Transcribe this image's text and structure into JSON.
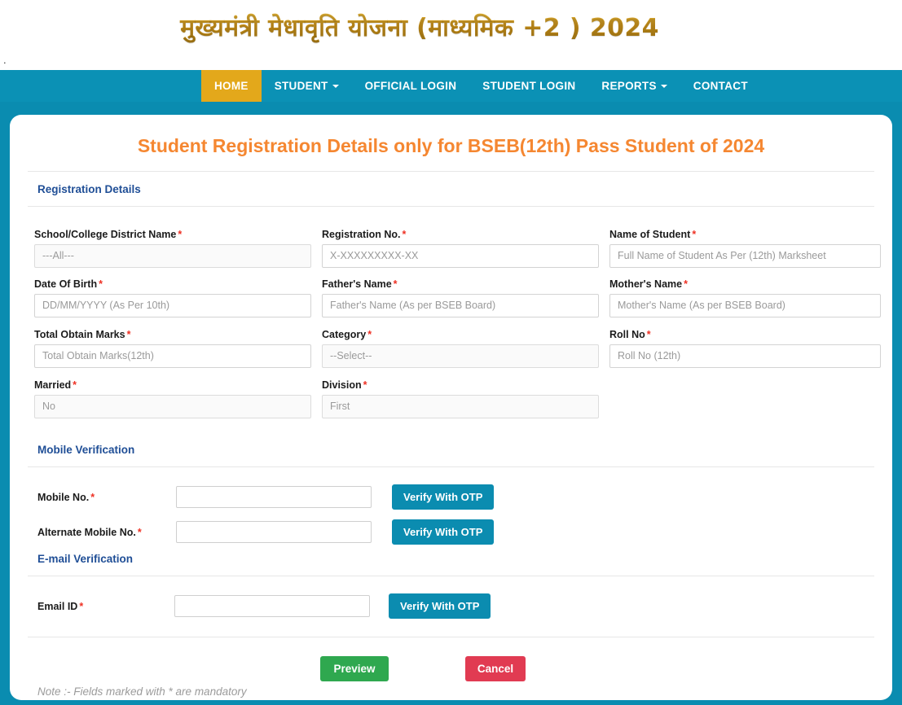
{
  "banner": {
    "title": "मुख्यमंत्री मेधावृति योजना (माध्यमिक +2 ) 2024",
    "stray_mark": "."
  },
  "nav": {
    "items": [
      {
        "label": "HOME",
        "active": true,
        "has_caret": false
      },
      {
        "label": "STUDENT",
        "active": false,
        "has_caret": true
      },
      {
        "label": "OFFICIAL LOGIN",
        "active": false,
        "has_caret": false
      },
      {
        "label": "STUDENT LOGIN",
        "active": false,
        "has_caret": false
      },
      {
        "label": "REPORTS",
        "active": false,
        "has_caret": true
      },
      {
        "label": "CONTACT",
        "active": false,
        "has_caret": false
      }
    ]
  },
  "card": {
    "title": "Student Registration Details only for BSEB(12th) Pass Student of 2024",
    "sections": {
      "registration": "Registration Details",
      "mobile": "Mobile Verification",
      "email": "E-mail Verification"
    }
  },
  "fields": {
    "district": {
      "label": "School/College District Name",
      "required": "*",
      "value": "---All---",
      "type": "select"
    },
    "regno": {
      "label": "Registration No.",
      "required": "*",
      "value": "X-XXXXXXXXX-XX",
      "type": "text"
    },
    "student": {
      "label": "Name of Student",
      "required": "*",
      "value": "Full Name of Student As Per (12th) Marksheet",
      "type": "text"
    },
    "dob": {
      "label": "Date Of Birth",
      "required": "*",
      "value": "DD/MM/YYYY (As Per 10th)",
      "type": "text"
    },
    "father": {
      "label": "Father's Name",
      "required": "*",
      "value": "Father's Name (As per BSEB Board)",
      "type": "text"
    },
    "mother": {
      "label": "Mother's Name",
      "required": "*",
      "value": "Mother's Name (As per BSEB Board)",
      "type": "text"
    },
    "marks": {
      "label": "Total Obtain Marks",
      "required": "*",
      "value": "Total Obtain Marks(12th)",
      "type": "text"
    },
    "category": {
      "label": "Category",
      "required": "*",
      "value": "--Select--",
      "type": "select"
    },
    "rollno": {
      "label": "Roll No",
      "required": "*",
      "value": "Roll No (12th)",
      "type": "text"
    },
    "married": {
      "label": "Married",
      "required": "*",
      "value": "No",
      "type": "select"
    },
    "division": {
      "label": "Division",
      "required": "*",
      "value": "First",
      "type": "select"
    }
  },
  "verification": {
    "mobile": {
      "label": "Mobile No.",
      "required": "*",
      "value": "",
      "button": "Verify With OTP"
    },
    "alt_mobile": {
      "label": "Alternate Mobile No.",
      "required": "*",
      "value": "",
      "button": "Verify With OTP"
    },
    "email": {
      "label": "Email ID",
      "required": "*",
      "value": "",
      "button": "Verify With OTP"
    }
  },
  "actions": {
    "preview": "Preview",
    "cancel": "Cancel",
    "note": "Note :- Fields marked with * are mandatory"
  },
  "colors": {
    "teal": "#0a8cb0",
    "nav_teal": "#0b91b5",
    "gold": "#e3a81b",
    "title_orange": "#f58731",
    "section_blue": "#1f4e96",
    "required_red": "#ee3124",
    "green": "#2fa84f",
    "red": "#e13b52"
  }
}
